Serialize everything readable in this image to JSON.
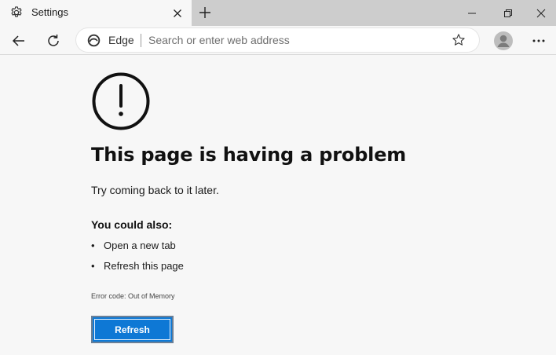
{
  "tab": {
    "title": "Settings",
    "icon": "gear-icon"
  },
  "window_controls": [
    "minimize-icon",
    "restore-icon",
    "close-icon"
  ],
  "toolbar": {
    "site_label": "Edge",
    "address_placeholder": "Search or enter web address",
    "address_value": ""
  },
  "error": {
    "title": "This page is having a problem",
    "subtitle": "Try coming back to it later.",
    "also_heading": "You could also:",
    "suggestions": [
      "Open a new tab",
      "Refresh this page"
    ],
    "bullet": "•",
    "code": "Error code: Out of Memory",
    "refresh_label": "Refresh"
  },
  "colors": {
    "accent": "#0f7ad6",
    "tabstrip": "#cdcdcd",
    "page_bg": "#f7f7f7"
  }
}
